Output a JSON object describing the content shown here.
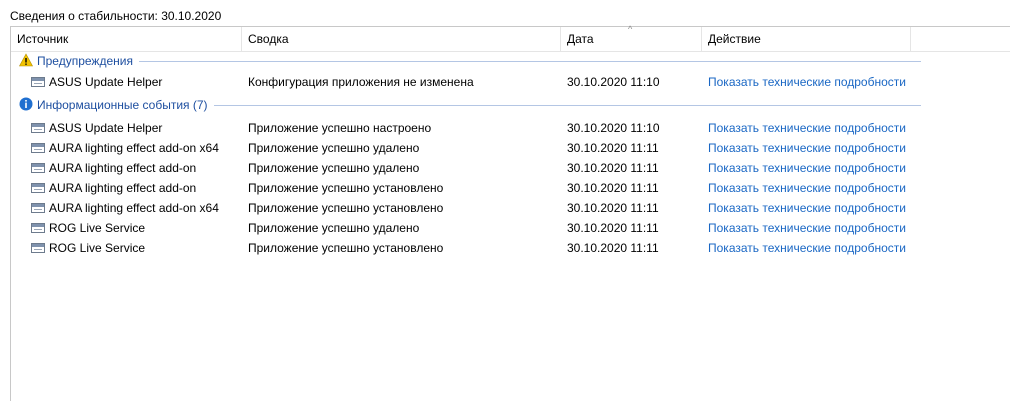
{
  "title": "Сведения о стабильности: 30.10.2020",
  "columns": {
    "source": "Источник",
    "summary": "Сводка",
    "date": "Дата",
    "action": "Действие",
    "sort_indicator": "^"
  },
  "groups": [
    {
      "label": "Предупреждения",
      "icon": "warning-icon",
      "rows": [
        {
          "source": "ASUS Update Helper",
          "summary": "Конфигурация приложения не изменена",
          "date": "30.10.2020 11:10",
          "action": "Показать технические подробности"
        }
      ]
    },
    {
      "label": "Информационные события (7)",
      "icon": "info-icon",
      "rows": [
        {
          "source": "ASUS Update Helper",
          "summary": "Приложение успешно настроено",
          "date": "30.10.2020 11:10",
          "action": "Показать технические подробности"
        },
        {
          "source": "AURA lighting effect add-on x64",
          "summary": "Приложение успешно удалено",
          "date": "30.10.2020 11:11",
          "action": "Показать технические подробности"
        },
        {
          "source": "AURA lighting effect add-on",
          "summary": "Приложение успешно удалено",
          "date": "30.10.2020 11:11",
          "action": "Показать технические подробности"
        },
        {
          "source": "AURA lighting effect add-on",
          "summary": "Приложение успешно установлено",
          "date": "30.10.2020 11:11",
          "action": "Показать технические подробности"
        },
        {
          "source": "AURA lighting effect add-on x64",
          "summary": "Приложение успешно установлено",
          "date": "30.10.2020 11:11",
          "action": "Показать технические подробности"
        },
        {
          "source": "ROG Live Service",
          "summary": "Приложение успешно удалено",
          "date": "30.10.2020 11:11",
          "action": "Показать технические подробности"
        },
        {
          "source": "ROG Live Service",
          "summary": "Приложение успешно установлено",
          "date": "30.10.2020 11:11",
          "action": "Показать технические подробности"
        }
      ]
    }
  ],
  "colors": {
    "link": "#1a67c4",
    "group_label": "#1e4fa0",
    "warning": "#f2c200",
    "info": "#1f6fd0"
  }
}
